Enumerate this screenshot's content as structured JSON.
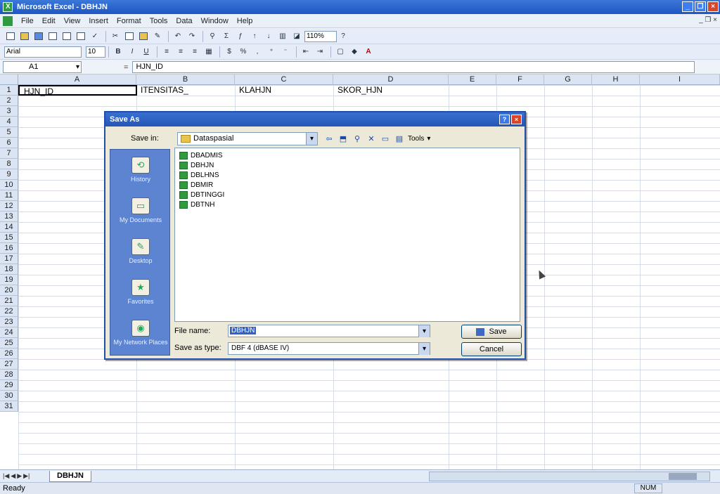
{
  "window": {
    "title": "Microsoft Excel - DBHJN"
  },
  "menu": {
    "items": [
      "File",
      "Edit",
      "View",
      "Insert",
      "Format",
      "Tools",
      "Data",
      "Window",
      "Help"
    ]
  },
  "toolbar": {
    "zoom": "110%",
    "font": "Arial",
    "font_size": "10",
    "bold": "B",
    "italic": "I",
    "underline": "U"
  },
  "formula_bar": {
    "name_box": "A1",
    "fx": "=",
    "content": "HJN_ID"
  },
  "grid": {
    "columns": [
      "A",
      "B",
      "C",
      "D",
      "E",
      "F",
      "G",
      "H",
      "I"
    ],
    "rows": [
      "1",
      "2",
      "3",
      "4",
      "5",
      "6",
      "7",
      "8",
      "9",
      "10",
      "11",
      "12",
      "13",
      "14",
      "15",
      "16",
      "17",
      "18",
      "19",
      "20",
      "21",
      "22",
      "23",
      "24",
      "25",
      "26",
      "27",
      "28",
      "29",
      "30",
      "31"
    ],
    "cells": {
      "A1": "HJN_ID",
      "B1": "ITENSITAS_",
      "C1": "KLAHJN",
      "D1": "SKOR_HJN"
    }
  },
  "sheet_tab": "DBHJN",
  "status": {
    "ready": "Ready",
    "num": "NUM"
  },
  "dialog": {
    "title": "Save As",
    "save_in_label": "Save in:",
    "save_in_value": "Dataspasial",
    "tools_label": "Tools",
    "places": [
      "History",
      "My Documents",
      "Desktop",
      "Favorites",
      "My Network Places"
    ],
    "files": [
      "DBADMIS",
      "DBHJN",
      "DBLHNS",
      "DBMIR",
      "DBTINGGI",
      "DBTNH"
    ],
    "file_name_label": "File name:",
    "file_name_value": "DBHJN",
    "save_type_label": "Save as type:",
    "save_type_value": "DBF 4 (dBASE IV)",
    "save_button": "Save",
    "cancel_button": "Cancel"
  }
}
